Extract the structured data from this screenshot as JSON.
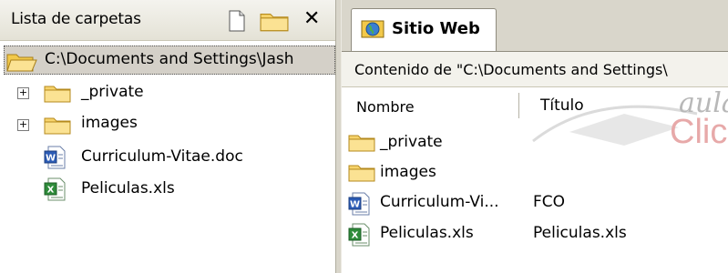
{
  "left_pane": {
    "title": "Lista de carpetas",
    "close_glyph": "✕",
    "root": {
      "label": "C:\\Documents and Settings\\Jash",
      "icon": "folder-open-icon"
    },
    "items": [
      {
        "label": "_private",
        "icon": "folder-icon",
        "expandable": true
      },
      {
        "label": "images",
        "icon": "folder-icon",
        "expandable": true
      },
      {
        "label": "Curriculum-Vitae.doc",
        "icon": "word-doc-icon",
        "expandable": false
      },
      {
        "label": "Peliculas.xls",
        "icon": "excel-xls-icon",
        "expandable": false
      }
    ]
  },
  "right_pane": {
    "tab": {
      "label": "Sitio Web",
      "icon": "website-globe-icon"
    },
    "content_path": "Contenido de \"C:\\Documents and Settings\\",
    "columns": {
      "name": "Nombre",
      "title": "Título"
    },
    "watermark": {
      "line1": "aula",
      "line2": "Clic"
    },
    "rows": [
      {
        "name": "_private",
        "title": "",
        "icon": "folder-icon"
      },
      {
        "name": "images",
        "title": "",
        "icon": "folder-icon"
      },
      {
        "name": "Curriculum-Vi...",
        "title": "FCO",
        "icon": "word-doc-icon"
      },
      {
        "name": "Peliculas.xls",
        "title": "Peliculas.xls",
        "icon": "excel-xls-icon"
      }
    ]
  },
  "colors": {
    "header_bg": "#e4e2d6",
    "selection_bg": "#d4d0c8",
    "folder_yellow": "#f2c94a",
    "word_blue": "#2b5bb5",
    "excel_green": "#2e8b3a"
  }
}
